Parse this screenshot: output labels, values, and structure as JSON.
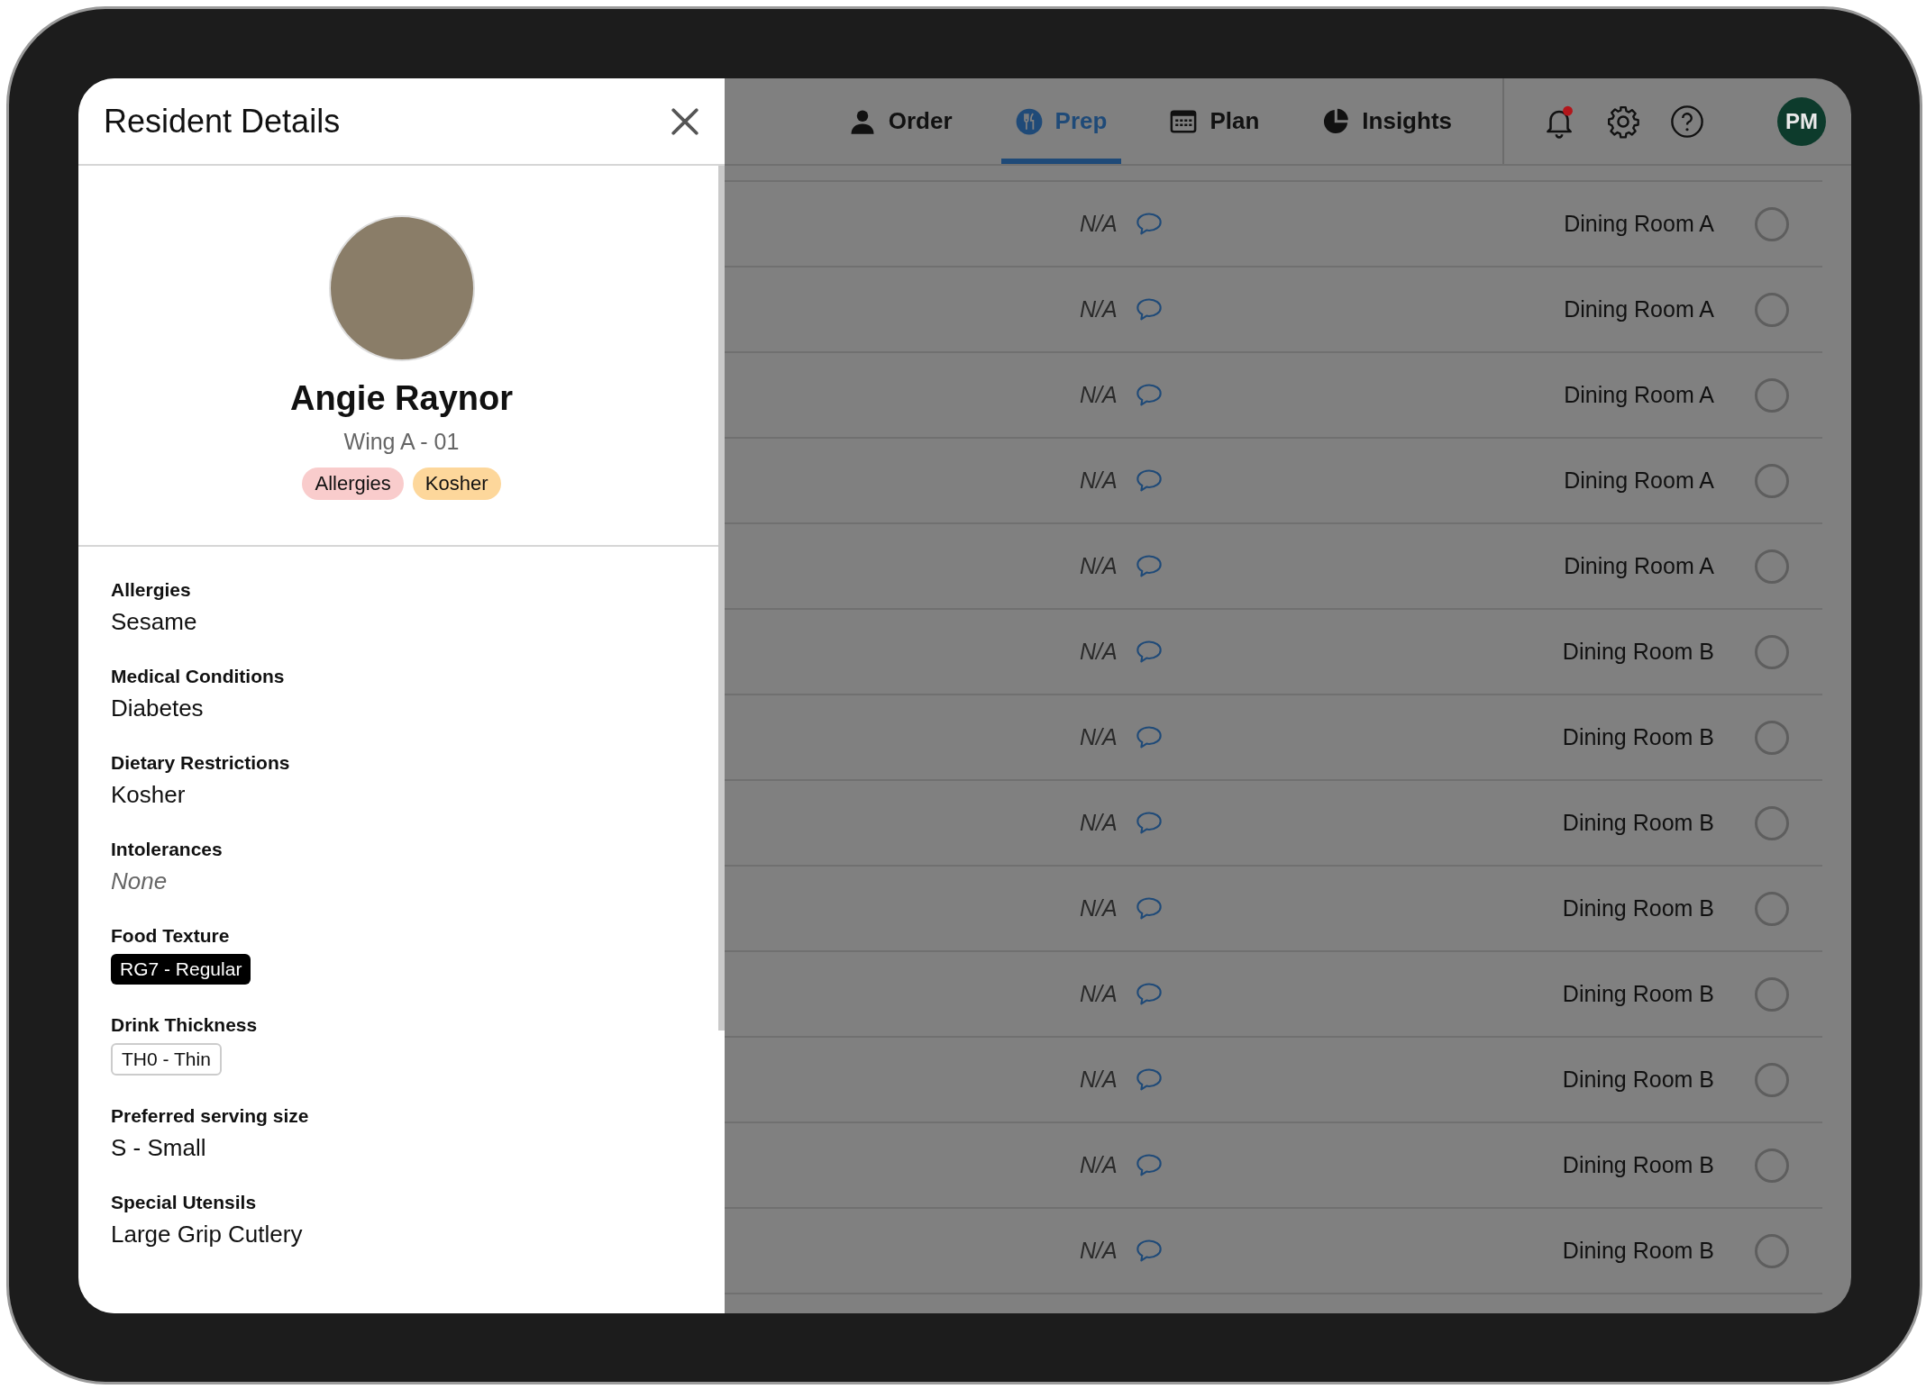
{
  "panel": {
    "title": "Resident Details",
    "resident": {
      "name": "Angie Raynor",
      "location": "Wing A - 01",
      "tags": [
        {
          "label": "Allergies",
          "color": "#f9cccc"
        },
        {
          "label": "Kosher",
          "color": "#fdd79b"
        }
      ]
    },
    "fields": [
      {
        "label": "Allergies",
        "value": "Sesame",
        "kind": "text"
      },
      {
        "label": "Medical Conditions",
        "value": "Diabetes",
        "kind": "text"
      },
      {
        "label": "Dietary Restrictions",
        "value": "Kosher",
        "kind": "text"
      },
      {
        "label": "Intolerances",
        "value": "None",
        "kind": "empty"
      },
      {
        "label": "Food Texture",
        "value": "RG7 - Regular",
        "kind": "solid-badge"
      },
      {
        "label": "Drink Thickness",
        "value": "TH0 - Thin",
        "kind": "outline-badge"
      },
      {
        "label": "Preferred serving size",
        "value": "S - Small",
        "kind": "text"
      },
      {
        "label": "Special Utensils",
        "value": "Large Grip Cutlery",
        "kind": "text"
      }
    ]
  },
  "nav": {
    "tabs": [
      {
        "label": "Order",
        "selected": false
      },
      {
        "label": "Prep",
        "selected": true
      },
      {
        "label": "Plan",
        "selected": false
      },
      {
        "label": "Insights",
        "selected": false
      }
    ],
    "notifications_unread": true,
    "avatar": "PM"
  },
  "rows": [
    {
      "note": "N/A",
      "location": "Dining Room A",
      "checked": false
    },
    {
      "note": "N/A",
      "location": "Dining Room A",
      "checked": false
    },
    {
      "note": "N/A",
      "location": "Dining Room A",
      "checked": false
    },
    {
      "note": "N/A",
      "location": "Dining Room A",
      "checked": false
    },
    {
      "note": "N/A",
      "location": "Dining Room A",
      "checked": false
    },
    {
      "note": "N/A",
      "location": "Dining Room B",
      "checked": false
    },
    {
      "note": "N/A",
      "location": "Dining Room B",
      "checked": false
    },
    {
      "note": "N/A",
      "location": "Dining Room B",
      "checked": false
    },
    {
      "note": "N/A",
      "location": "Dining Room B",
      "checked": false
    },
    {
      "note": "N/A",
      "location": "Dining Room B",
      "checked": false
    },
    {
      "note": "N/A",
      "location": "Dining Room B",
      "checked": false
    },
    {
      "note": "N/A",
      "location": "Dining Room B",
      "checked": false
    },
    {
      "note": "N/A",
      "location": "Dining Room B",
      "checked": false
    }
  ]
}
